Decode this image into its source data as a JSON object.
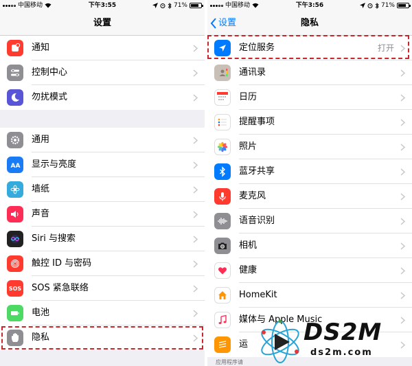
{
  "left": {
    "status": {
      "carrier": "中国移动",
      "time": "下午3:55",
      "battery": "71%"
    },
    "nav": {
      "title": "设置"
    },
    "group1": [
      {
        "label": "通知",
        "icon": "notification-icon",
        "color": "#ff3b30"
      },
      {
        "label": "控制中心",
        "icon": "control-center-icon",
        "color": "#8e8e93"
      },
      {
        "label": "勿扰模式",
        "icon": "moon-icon",
        "color": "#5856d6"
      }
    ],
    "group2": [
      {
        "label": "通用",
        "icon": "gear-icon",
        "color": "#8e8e93"
      },
      {
        "label": "显示与亮度",
        "icon": "display-icon",
        "color": "#1a7cf5"
      },
      {
        "label": "墙纸",
        "icon": "wallpaper-icon",
        "color": "#35aadc"
      },
      {
        "label": "声音",
        "icon": "sound-icon",
        "color": "#ff2d55"
      },
      {
        "label": "Siri 与搜索",
        "icon": "siri-icon",
        "color": "#222"
      },
      {
        "label": "触控 ID 与密码",
        "icon": "fingerprint-icon",
        "color": "#ff3b30"
      },
      {
        "label": "SOS 紧急联络",
        "icon": "sos-icon",
        "color": "#ff3b30",
        "icon_text": "SOS"
      },
      {
        "label": "电池",
        "icon": "battery-icon",
        "color": "#4cd964"
      },
      {
        "label": "隐私",
        "icon": "hand-icon",
        "color": "#8e8e93"
      }
    ]
  },
  "right": {
    "status": {
      "carrier": "中国移动",
      "time": "下午3:56",
      "battery": "71%"
    },
    "nav": {
      "title": "隐私",
      "back": "设置"
    },
    "items": [
      {
        "label": "定位服务",
        "value": "打开",
        "icon": "location-icon",
        "color": "#007aff"
      },
      {
        "label": "通讯录",
        "icon": "contacts-icon",
        "color": "#c8c0b6"
      },
      {
        "label": "日历",
        "icon": "calendar-icon",
        "color": "#ffffff"
      },
      {
        "label": "提醒事项",
        "icon": "reminders-icon",
        "color": "#ffffff"
      },
      {
        "label": "照片",
        "icon": "photos-icon",
        "color": "#ffffff"
      },
      {
        "label": "蓝牙共享",
        "icon": "bluetooth-icon",
        "color": "#007aff"
      },
      {
        "label": "麦克风",
        "icon": "microphone-icon",
        "color": "#ff3b30"
      },
      {
        "label": "语音识别",
        "icon": "speech-icon",
        "color": "#8e8e93"
      },
      {
        "label": "相机",
        "icon": "camera-icon",
        "color": "#8e8e93"
      },
      {
        "label": "健康",
        "icon": "health-icon",
        "color": "#ffffff"
      },
      {
        "label": "HomeKit",
        "icon": "home-icon",
        "color": "#ffffff"
      },
      {
        "label": "媒体与 Apple Music",
        "icon": "music-icon",
        "color": "#ffffff"
      },
      {
        "label": "运",
        "icon": "motion-icon",
        "color": "#ff9500"
      }
    ],
    "footer": "应用程序请"
  },
  "watermark": {
    "brand": "DS2M",
    "url": "ds2m.com"
  },
  "highlight_color": "#c9252a"
}
